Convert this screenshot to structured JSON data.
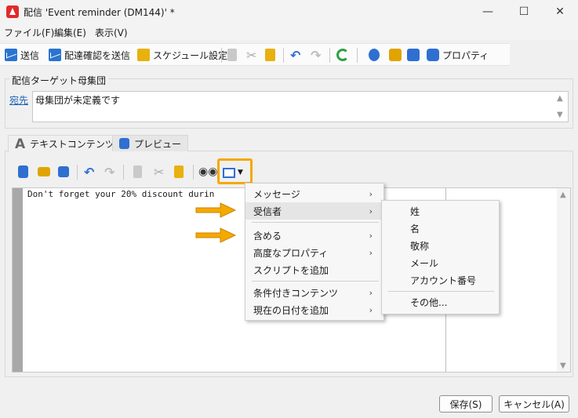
{
  "window": {
    "title": "配信 'Event reminder (DM144)' *",
    "minimize": "—",
    "maximize": "☐",
    "close": "✕"
  },
  "menubar": {
    "file": "ファイル(F)",
    "edit": "編集(E)",
    "view": "表示(V)"
  },
  "toolbar": {
    "send": "送信",
    "send_proof": "配達確認を送信",
    "schedule": "スケジュール設定",
    "properties": "プロパティ"
  },
  "target": {
    "group_label": "配信ターゲット母集団",
    "to_link": "宛先",
    "to_value": "母集団が未定義です"
  },
  "tabs": [
    {
      "label": "テキストコンテンツ",
      "icon": "A"
    },
    {
      "label": "プレビュー"
    }
  ],
  "editor": {
    "content": "Don't forget your 20% discount durin"
  },
  "context_menu": {
    "items": [
      "メッセージ",
      "受信者",
      "含める",
      "高度なプロパティ",
      "スクリプトを追加",
      "条件付きコンテンツ",
      "現在の日付を追加"
    ],
    "submenu_items": [
      "姓",
      "名",
      "敬称",
      "メール",
      "アカウント番号",
      "その他..."
    ]
  },
  "buttons": {
    "save": "保存(S)",
    "cancel": "キャンセル(A)"
  },
  "colors": {
    "highlight": "#f5a800",
    "link": "#1a5fb4",
    "accent_red": "#e02b2b"
  }
}
